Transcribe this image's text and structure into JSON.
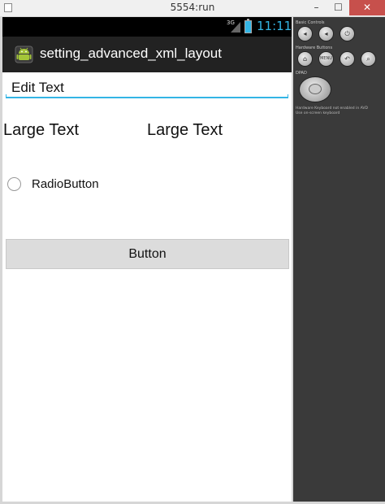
{
  "window": {
    "title": "5554:run",
    "minimize_glyph": "–",
    "maximize_glyph": "☐",
    "close_glyph": "✕"
  },
  "status_bar": {
    "network": "3G",
    "time": "11:11",
    "colors": {
      "background": "#000000",
      "accent": "#33b5e5"
    }
  },
  "action_bar": {
    "app_icon": "android-icon",
    "title": "setting_advanced_xml_layout",
    "background": "#222222"
  },
  "form": {
    "edit_text_value": "Edit Text",
    "large_text_1": "Large Text",
    "large_text_2": "Large Text",
    "radio_label": "RadioButton",
    "radio_checked": false,
    "button_label": "Button"
  },
  "emulator_controls": {
    "basic_controls_label": "Basic Controls",
    "hardware_buttons_label": "Hardware Buttons",
    "dpad_label": "DPAD",
    "menu_label": "MENU",
    "keyboard_note_1": "Hardware Keyboard not enabled in AVD",
    "keyboard_note_2": "Use on-screen keyboard",
    "icons": [
      "volume-down-icon",
      "volume-up-icon",
      "power-icon",
      "home-icon",
      "menu-icon",
      "back-icon",
      "search-icon",
      "dpad-icon"
    ]
  }
}
